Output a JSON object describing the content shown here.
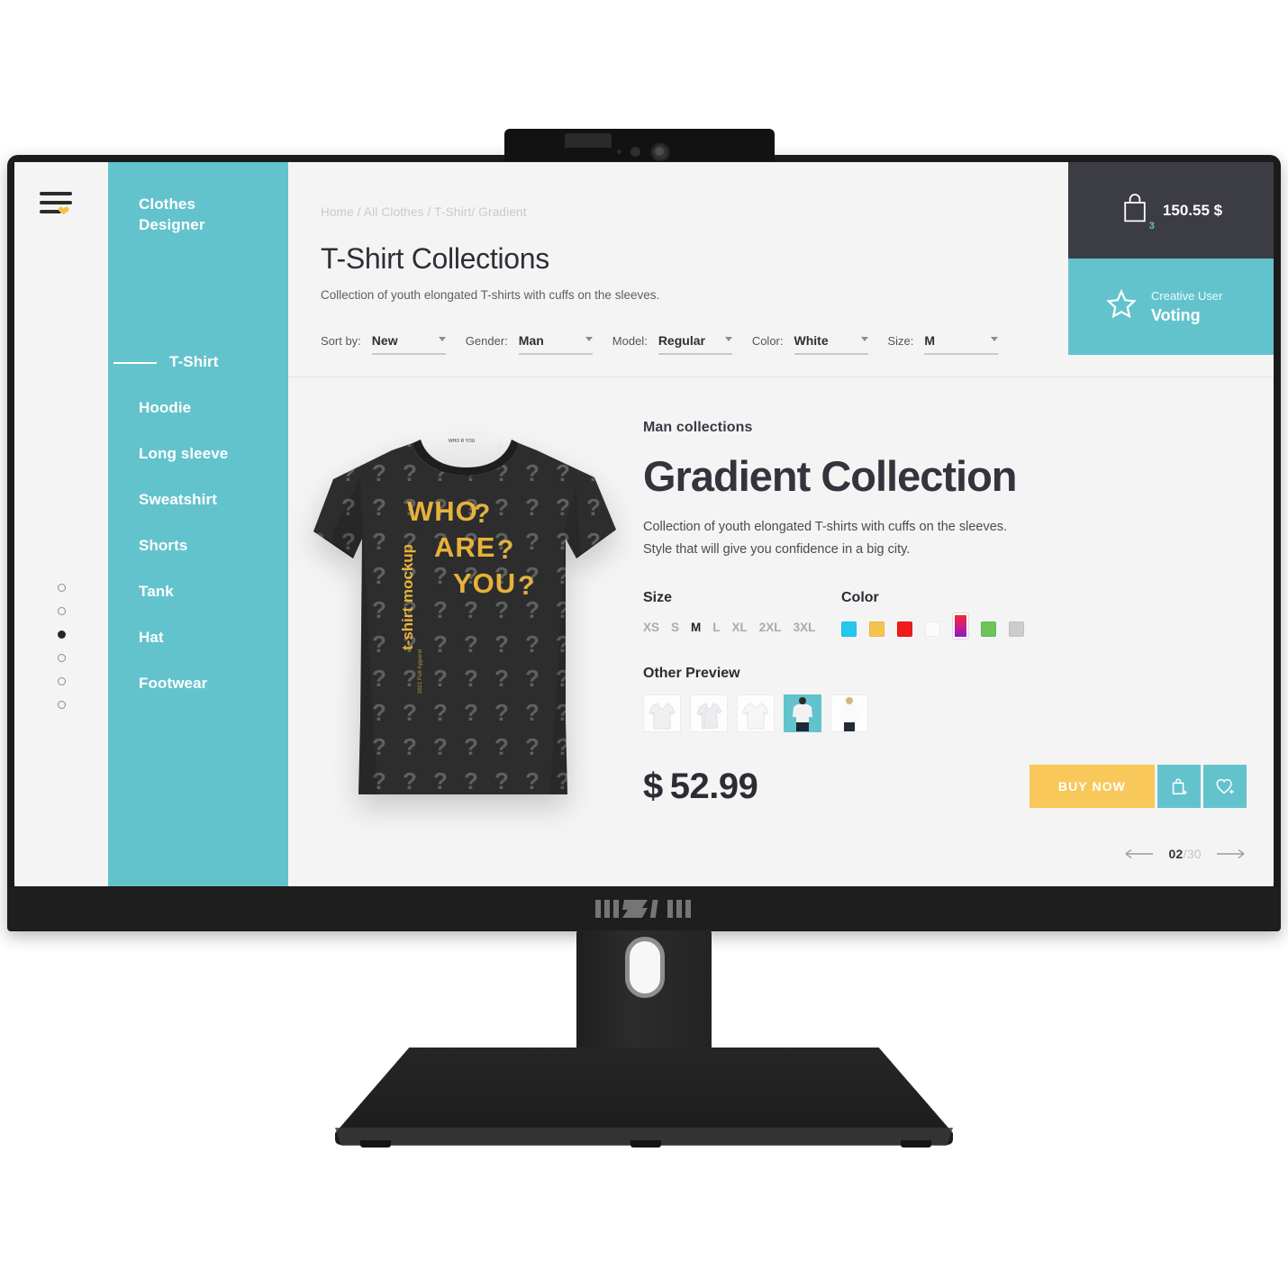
{
  "device": {
    "brand_logo": "MSI",
    "webcam": "webcam-module"
  },
  "sidebar": {
    "brand_line1": "Clothes",
    "brand_line2": "Designer",
    "items": [
      {
        "label": "T-Shirt",
        "active": true
      },
      {
        "label": "Hoodie",
        "active": false
      },
      {
        "label": "Long sleeve",
        "active": false
      },
      {
        "label": "Sweatshirt",
        "active": false
      },
      {
        "label": "Shorts",
        "active": false
      },
      {
        "label": "Tank",
        "active": false
      },
      {
        "label": "Hat",
        "active": false
      },
      {
        "label": "Footwear",
        "active": false
      }
    ],
    "accent_color": "#63c3cd"
  },
  "rail": {
    "menu_icon": "hamburger-icon",
    "heart_icon": "heart-icon",
    "heart_color": "#f5c249",
    "dots": 6,
    "active_dot": 3
  },
  "header": {
    "breadcrumb": "Home / All Clothes / T-Shirt/ Gradient",
    "title": "T-Shirt Collections",
    "subtitle": "Collection of youth elongated T-shirts with cuffs on  the sleeves."
  },
  "filters": [
    {
      "label": "Sort by:",
      "value": "New"
    },
    {
      "label": "Gender:",
      "value": "Man"
    },
    {
      "label": "Model:",
      "value": "Regular"
    },
    {
      "label": "Color:",
      "value": "White"
    },
    {
      "label": "Size:",
      "value": "M"
    }
  ],
  "cart": {
    "total": "150.55 $",
    "count": "3",
    "icon": "shopping-bag-icon"
  },
  "voting": {
    "line1": "Creative User",
    "line2": "Voting",
    "icon": "star-icon"
  },
  "product": {
    "eyebrow": "Man collections",
    "title": "Gradient Collection",
    "desc_line1": "Collection of youth elongated T-shirts with cuffs on the sleeves.",
    "desc_line2": "Style that will give you confidence in a big city.",
    "size_head": "Size",
    "sizes": [
      {
        "label": "XS",
        "active": false
      },
      {
        "label": "S",
        "active": false
      },
      {
        "label": "M",
        "active": true
      },
      {
        "label": "L",
        "active": false
      },
      {
        "label": "XL",
        "active": false
      },
      {
        "label": "2XL",
        "active": false
      },
      {
        "label": "3XL",
        "active": false
      }
    ],
    "color_head": "Color",
    "colors": [
      {
        "name": "cyan",
        "hex": "#24c8ee",
        "selected": false
      },
      {
        "name": "gold",
        "hex": "#f5c44c",
        "selected": false
      },
      {
        "name": "red",
        "hex": "#f01b1b",
        "selected": false
      },
      {
        "name": "white",
        "hex": "#fbfbfb",
        "selected": false
      },
      {
        "name": "gradient",
        "hex": "#a01ab4",
        "selected": true
      },
      {
        "name": "green",
        "hex": "#6cc45a",
        "selected": false
      },
      {
        "name": "gray",
        "hex": "#cccccc",
        "selected": false
      }
    ],
    "preview_head": "Other Preview",
    "previews": [
      {
        "name": "tee-front-flat",
        "active": false
      },
      {
        "name": "tee-angled",
        "active": false
      },
      {
        "name": "tee-back-flat",
        "active": false
      },
      {
        "name": "model-front",
        "active": true
      },
      {
        "name": "model-side",
        "active": false
      }
    ],
    "currency": "$",
    "price": "52.99",
    "buy_label": "BUY NOW",
    "cart_icon": "add-to-bag-icon",
    "wish_icon": "add-to-wishlist-icon",
    "buy_color": "#f9c85a",
    "action_color": "#63c3cd",
    "artwork": {
      "line1": "WHO",
      "line2": "ARE",
      "line3": "YOU",
      "q": "?",
      "vertical": "t-shirt mockup",
      "text_color": "#e8b23a",
      "shirt_color": "#2d2d2d"
    }
  },
  "pager": {
    "current": "02",
    "total": "/30",
    "prev_icon": "arrow-left-icon",
    "next_icon": "arrow-right-icon"
  }
}
